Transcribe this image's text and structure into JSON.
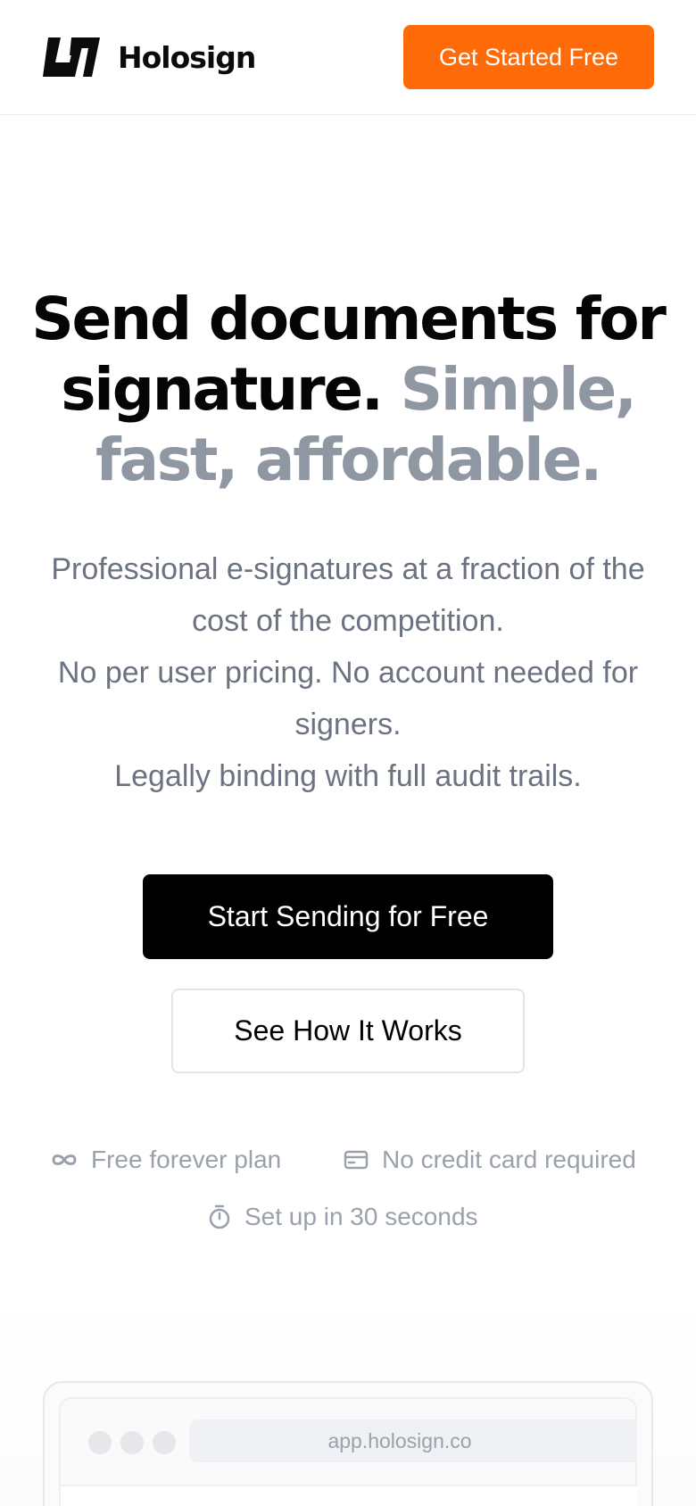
{
  "header": {
    "brand": "Holosign",
    "cta_label": "Get Started Free",
    "cta_color": "#FF6B08"
  },
  "hero": {
    "title_strong": "Send documents for signature.",
    "title_muted": "Simple, fast, affordable.",
    "subtitle_lines": [
      "Professional e-signatures at a fraction of the cost of the competition.",
      "No per user pricing. No account needed for signers.",
      "Legally binding with full audit trails."
    ],
    "primary_button": "Start Sending for Free",
    "secondary_button": "See How It Works"
  },
  "features": [
    {
      "icon": "infinity-icon",
      "label": "Free forever plan"
    },
    {
      "icon": "credit-card-icon",
      "label": "No credit card required"
    },
    {
      "icon": "stopwatch-icon",
      "label": "Set up in 30 seconds"
    }
  ],
  "mockup": {
    "url": "app.holosign.co"
  },
  "colors": {
    "accent": "#FF6B08",
    "muted_heading": "#8F97A3",
    "body_text": "#6B7280"
  }
}
